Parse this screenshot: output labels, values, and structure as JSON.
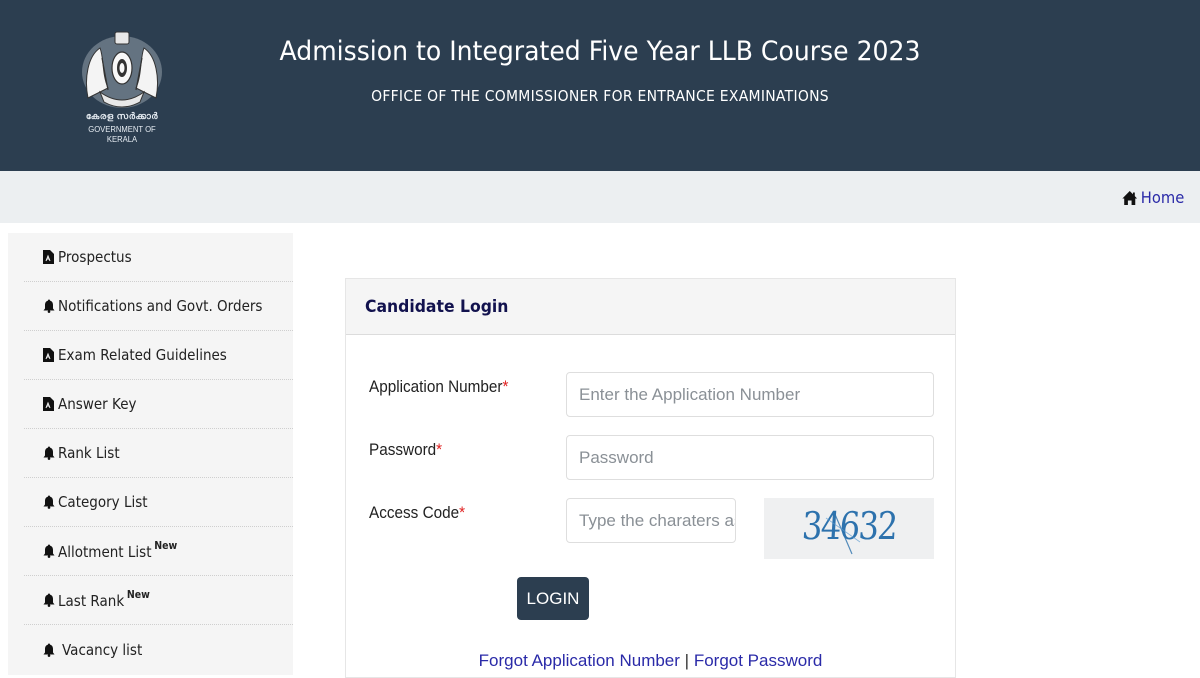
{
  "header": {
    "emblem_malayalam": "കേരള സർക്കാർ",
    "emblem_caption": "GOVERNMENT OF KERALA",
    "title": "Admission to Integrated Five Year LLB Course 2023",
    "subtitle": "OFFICE OF THE COMMISSIONER FOR ENTRANCE EXAMINATIONS"
  },
  "navbar": {
    "home_label": "Home",
    "home_icon": "home-icon"
  },
  "sidebar": {
    "items": [
      {
        "label": "Prospectus",
        "icon": "pdf-icon",
        "badge": ""
      },
      {
        "label": "Notifications and Govt. Orders",
        "icon": "bell-icon",
        "badge": ""
      },
      {
        "label": "Exam Related Guidelines",
        "icon": "pdf-icon",
        "badge": ""
      },
      {
        "label": "Answer Key",
        "icon": "pdf-icon",
        "badge": ""
      },
      {
        "label": "Rank List",
        "icon": "bell-icon",
        "badge": ""
      },
      {
        "label": "Category List",
        "icon": "bell-icon",
        "badge": ""
      },
      {
        "label": "Allotment List",
        "icon": "bell-icon",
        "badge": "New"
      },
      {
        "label": "Last Rank",
        "icon": "bell-icon",
        "badge": "New"
      },
      {
        "label": "Vacancy list",
        "icon": "bell-icon",
        "badge": ""
      }
    ]
  },
  "login": {
    "title": "Candidate Login",
    "application_number": {
      "label": "Application Number",
      "required_mark": "*",
      "placeholder": "Enter the Application Number",
      "value": ""
    },
    "password": {
      "label": "Password",
      "required_mark": "*",
      "placeholder": "Password",
      "value": ""
    },
    "access_code": {
      "label": "Access Code",
      "required_mark": "*",
      "placeholder": "Type the charaters as in",
      "value": ""
    },
    "captcha_text": "34632",
    "login_button": "LOGIN",
    "forgot_application_number": "Forgot Application Number",
    "separator": "|",
    "forgot_password": "Forgot Password"
  },
  "colors": {
    "header_bg": "#2c3e50",
    "navbar_bg": "#eceff1",
    "link": "#2a2aa8",
    "card_title": "#12124e",
    "required": "#e02020",
    "captcha": "#2d72ad"
  }
}
